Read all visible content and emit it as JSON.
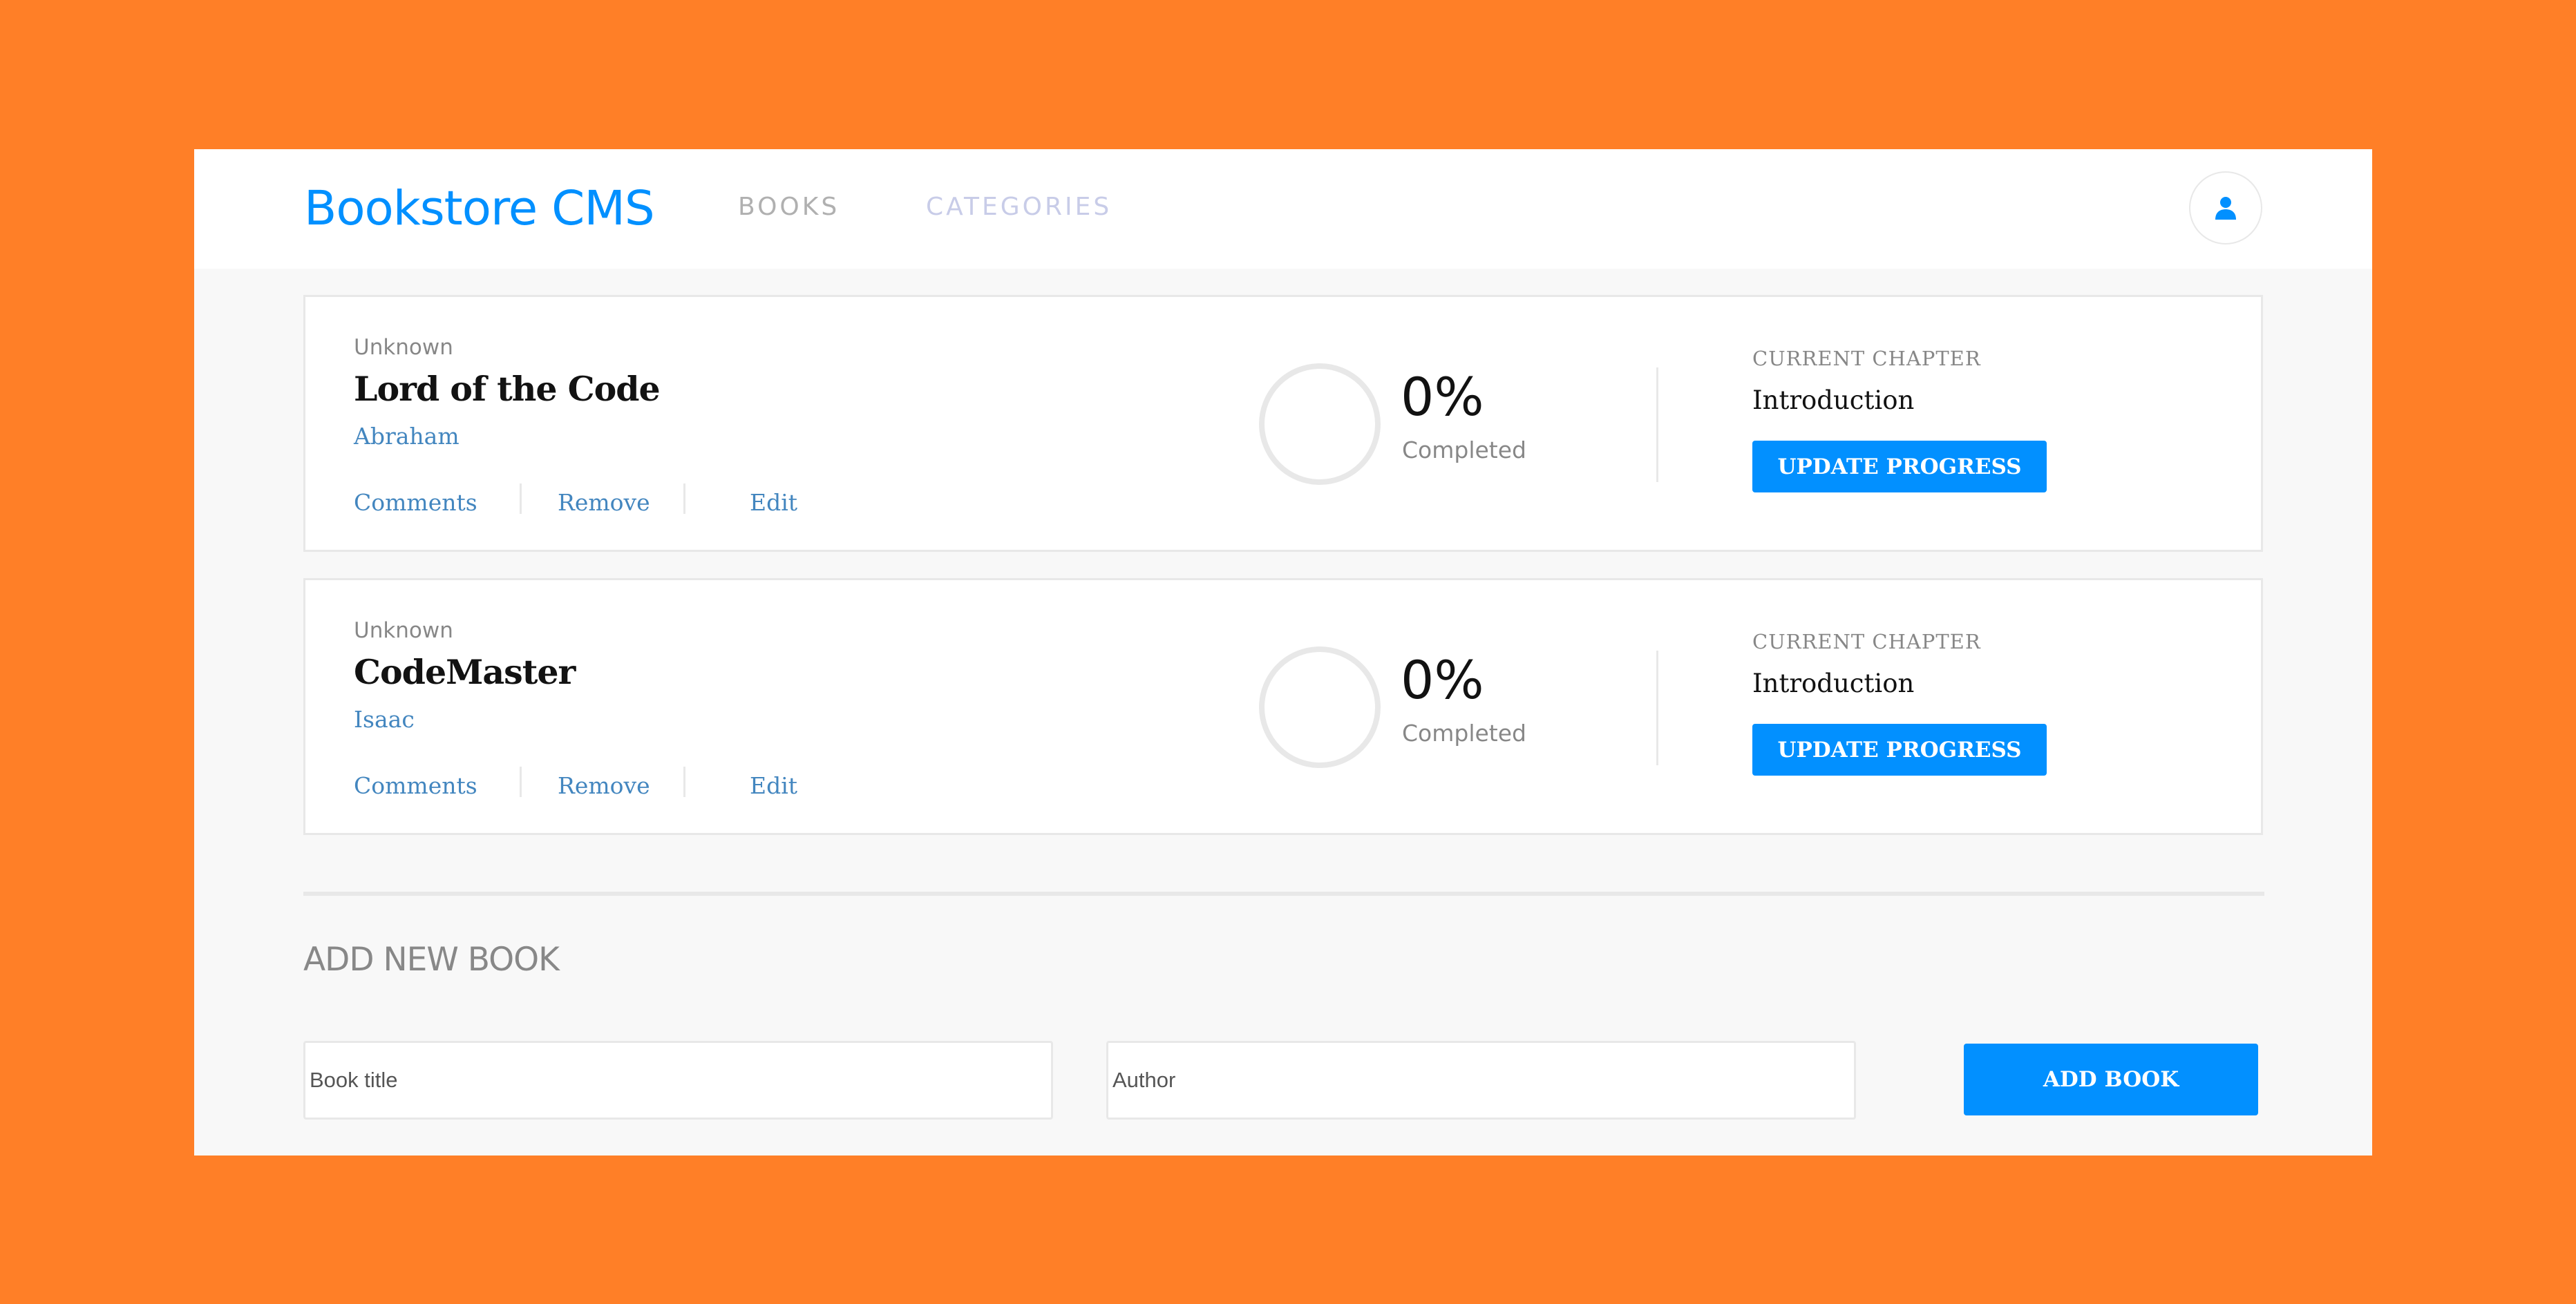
{
  "header": {
    "brand": "Bookstore CMS",
    "nav": [
      {
        "label": "BOOKS"
      },
      {
        "label": "CATEGORIES"
      }
    ],
    "user_icon": "user-icon"
  },
  "books": [
    {
      "genre": "Unknown",
      "title": "Lord of the Code",
      "author": "Abraham",
      "actions": {
        "comments": "Comments",
        "remove": "Remove",
        "edit": "Edit"
      },
      "progress_percent": "0%",
      "progress_value": 0,
      "progress_label": "Completed",
      "chapter_label": "CURRENT CHAPTER",
      "chapter": "Introduction",
      "update_label": "UPDATE PROGRESS"
    },
    {
      "genre": "Unknown",
      "title": "CodeMaster",
      "author": "Isaac",
      "actions": {
        "comments": "Comments",
        "remove": "Remove",
        "edit": "Edit"
      },
      "progress_percent": "0%",
      "progress_value": 0,
      "progress_label": "Completed",
      "chapter_label": "CURRENT CHAPTER",
      "chapter": "Introduction",
      "update_label": "UPDATE PROGRESS"
    }
  ],
  "form": {
    "title": "ADD NEW BOOK",
    "title_placeholder": "Book title",
    "author_placeholder": "Author",
    "submit_label": "ADD BOOK"
  },
  "colors": {
    "background": "#ff7f27",
    "accent": "#0290ff",
    "link": "#4386bf"
  }
}
